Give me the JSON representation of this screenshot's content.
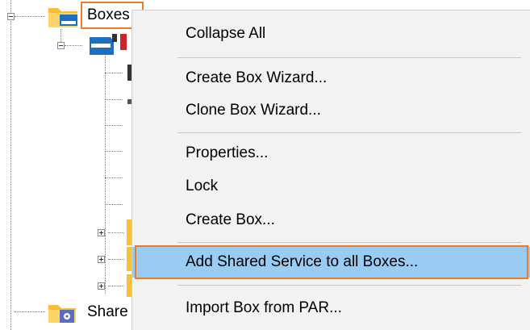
{
  "tree": {
    "boxes_label": "Boxes",
    "shared_label": "Share"
  },
  "context_menu": {
    "items": [
      {
        "label": "Collapse All"
      },
      {
        "label": "Create Box Wizard..."
      },
      {
        "label": "Clone Box Wizard..."
      },
      {
        "label": "Properties..."
      },
      {
        "label": "Lock"
      },
      {
        "label": "Create Box..."
      },
      {
        "label": "Add Shared Service to all Boxes..."
      },
      {
        "label": "Import Box from PAR..."
      }
    ],
    "active_item": "Add Shared Service to all Boxes..."
  },
  "colors": {
    "highlight_outline": "#ec7a29",
    "active_background": "#99ccf3",
    "menu_background": "#f2f2f2"
  },
  "icons": {
    "boxes_folder": "folder-box-icon",
    "child_box": "box-icon",
    "shared_folder": "folder-gear-icon"
  }
}
